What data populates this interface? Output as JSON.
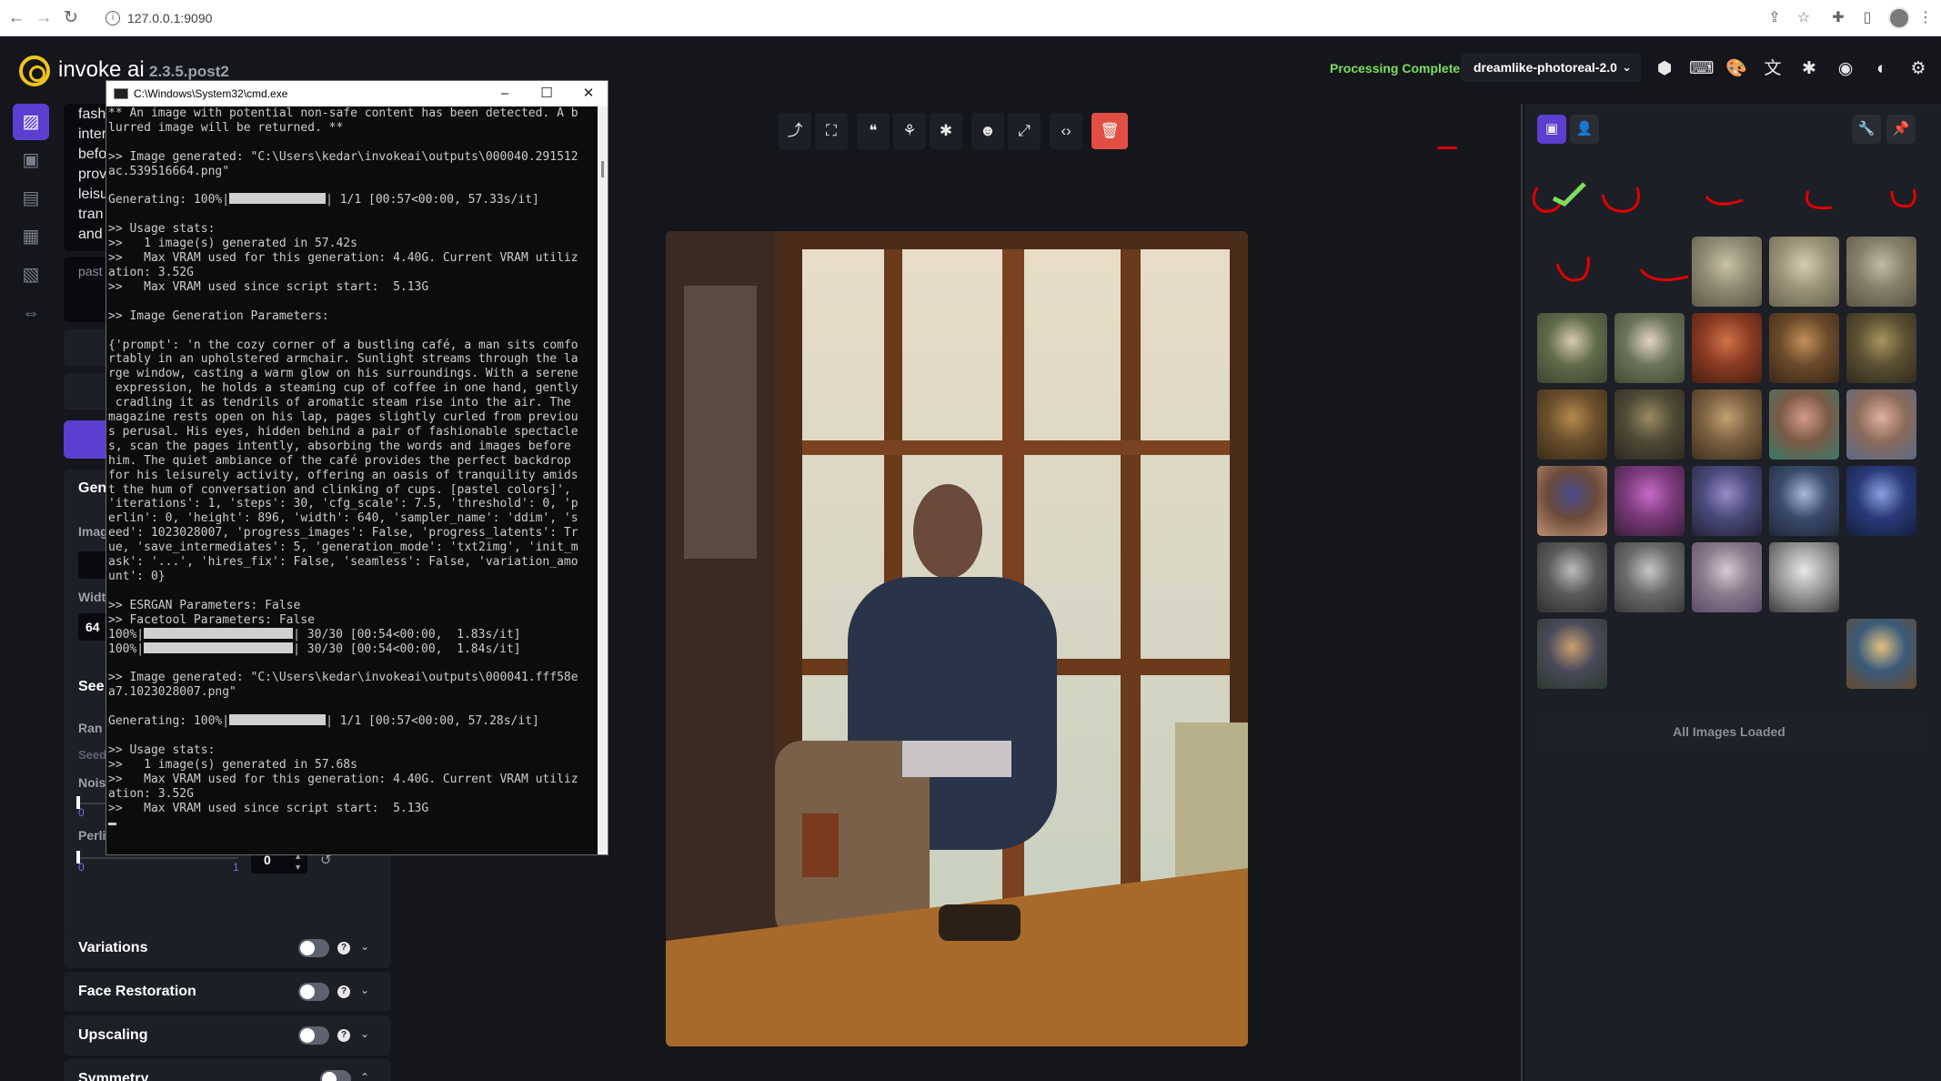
{
  "browser": {
    "url": "127.0.0.1:9090"
  },
  "app": {
    "brand": "invoke ai",
    "version": "2.3.5.post2",
    "status": "Processing Complete",
    "model": "dreamlike-photoreal-2.0"
  },
  "prompt": {
    "visible_lines": [
      "fash",
      "inter",
      "befo",
      "prov",
      "leisu",
      "tran",
      "and"
    ],
    "negative_placeholder": "past"
  },
  "options": {
    "general_title": "Gen",
    "image_label": "Imag",
    "width_label": "Widt",
    "width_value": "64",
    "seed_title": "See",
    "random_label": "Ran",
    "seed_label": "Seed",
    "noise_label": "Nois",
    "noise_min": "0",
    "perlin_label": "Perlin Noise",
    "perlin_min": "0",
    "perlin_max": "1",
    "perlin_value": "0",
    "sections": [
      {
        "label": "Variations"
      },
      {
        "label": "Face Restoration"
      },
      {
        "label": "Upscaling"
      },
      {
        "label": "Symmetry"
      }
    ]
  },
  "terminal": {
    "title": "C:\\Windows\\System32\\cmd.exe",
    "lines": [
      "** An image with potential non-safe content has been detected. A b",
      "lurred image will be returned. **",
      "",
      ">> Image generated: \"C:\\Users\\kedar\\invokeai\\outputs\\000040.291512",
      "ac.539516664.png\"",
      "",
      "Generating: 100%|{BAR}| 1/1 [00:57<00:00, 57.33s/it]",
      "",
      ">> Usage stats:",
      ">>   1 image(s) generated in 57.42s",
      ">>   Max VRAM used for this generation: 4.40G. Current VRAM utiliz",
      "ation: 3.52G",
      ">>   Max VRAM used since script start:  5.13G",
      "",
      ">> Image Generation Parameters:",
      "",
      "{'prompt': 'n the cozy corner of a bustling café, a man sits comfo",
      "rtably in an upholstered armchair. Sunlight streams through the la",
      "rge window, casting a warm glow on his surroundings. With a serene",
      " expression, he holds a steaming cup of coffee in one hand, gently",
      " cradling it as tendrils of aromatic steam rise into the air. The",
      "magazine rests open on his lap, pages slightly curled from previou",
      "s perusal. His eyes, hidden behind a pair of fashionable spectacle",
      "s, scan the pages intently, absorbing the words and images before",
      "him. The quiet ambiance of the café provides the perfect backdrop",
      "for his leisurely activity, offering an oasis of tranquility amids",
      "t the hum of conversation and clinking of cups. [pastel colors]',",
      "'iterations': 1, 'steps': 30, 'cfg_scale': 7.5, 'threshold': 0, 'p",
      "erlin': 0, 'height': 896, 'width': 640, 'sampler_name': 'ddim', 's",
      "eed': 1023028007, 'progress_images': False, 'progress_latents': Tr",
      "ue, 'save_intermediates': 5, 'generation_mode': 'txt2img', 'init_m",
      "ask': '...', 'hires_fix': False, 'seamless': False, 'variation_amo",
      "unt': 0}",
      "",
      ">> ESRGAN Parameters: False",
      ">> Facetool Parameters: False",
      "100%|{BAR2}| 30/30 [00:54<00:00,  1.83s/it]",
      "100%|{BAR2}| 30/30 [00:54<00:00,  1.84s/it]",
      "",
      ">> Image generated: \"C:\\Users\\kedar\\invokeai\\outputs\\000041.fff58e",
      "a7.1023028007.png\"",
      "",
      "Generating: 100%|{BAR}| 1/1 [00:57<00:00, 57.28s/it]",
      "",
      ">> Usage stats:",
      ">>   1 image(s) generated in 57.68s",
      ">>   Max VRAM used for this generation: 4.40G. Current VRAM utiliz",
      "ation: 3.52G",
      ">>   Max VRAM used since script start:  5.13G"
    ]
  },
  "gallery": {
    "footer": "All Images Loaded",
    "thumbs": [
      {
        "colors": [
          "#8f8a72",
          "#c9c2a6",
          "#5f5a48"
        ]
      },
      {
        "colors": [
          "#9b9479",
          "#d4cdb2",
          "#6a6350"
        ]
      },
      {
        "colors": [
          "#857f6a",
          "#c2bca3",
          "#5a5444"
        ]
      },
      {
        "colors": [
          "#5f6b4a",
          "#d8c9b2",
          "#3c4530"
        ]
      },
      {
        "colors": [
          "#6b745a",
          "#e2d3c4",
          "#444b36"
        ]
      },
      {
        "colors": [
          "#8a3b22",
          "#d0734a",
          "#4a1e12"
        ]
      },
      {
        "colors": [
          "#6b4a2a",
          "#c2915a",
          "#3a2718"
        ]
      },
      {
        "colors": [
          "#5a5032",
          "#a8955e",
          "#302a1c"
        ]
      },
      {
        "colors": [
          "#6a4f2c",
          "#b58a4e",
          "#3a2b18"
        ]
      },
      {
        "colors": [
          "#4f4a36",
          "#9a8a62",
          "#2c281e"
        ]
      },
      {
        "colors": [
          "#7a6040",
          "#c4a070",
          "#40301e"
        ]
      },
      {
        "colors": [
          "#7a5a46",
          "#d49a8a",
          "#3a7a6a"
        ]
      },
      {
        "colors": [
          "#8a6a5a",
          "#e0b0a0",
          "#5a6a8a"
        ]
      },
      {
        "colors": [
          "#6a4a3a",
          "#4a4a8a",
          "#c09070"
        ]
      },
      {
        "colors": [
          "#7a3a7a",
          "#c86ac8",
          "#3a1e3a"
        ]
      },
      {
        "colors": [
          "#4a4a7a",
          "#9a8ac8",
          "#22223a"
        ]
      },
      {
        "colors": [
          "#3a4a6a",
          "#a8b8d8",
          "#1e2a3a"
        ]
      },
      {
        "colors": [
          "#2a3a7a",
          "#8aa0e0",
          "#141e3a"
        ]
      },
      {
        "colors": [
          "#5a5a5a",
          "#bcbcbc",
          "#2e2e2e"
        ]
      },
      {
        "colors": [
          "#6a6a6a",
          "#c8c8c8",
          "#383838"
        ]
      },
      {
        "colors": [
          "#8a7a8a",
          "#d8c8d8",
          "#5a4a6a"
        ]
      },
      {
        "colors": [
          "#9a9a9a",
          "#e8e8e8",
          "#3a3a3a"
        ]
      },
      {
        "colors": [
          "#4a4a5a",
          "#c8a070",
          "#2a3a2a"
        ]
      },
      {
        "colors": [
          "#3a5a7a",
          "#e0c080",
          "#6a4a2a"
        ]
      }
    ]
  },
  "colors": {
    "accent": "#5a3fd1",
    "status_green": "#7dde5c",
    "danger": "#e24e42",
    "background": "#15161c",
    "panel": "#1d1f26"
  }
}
